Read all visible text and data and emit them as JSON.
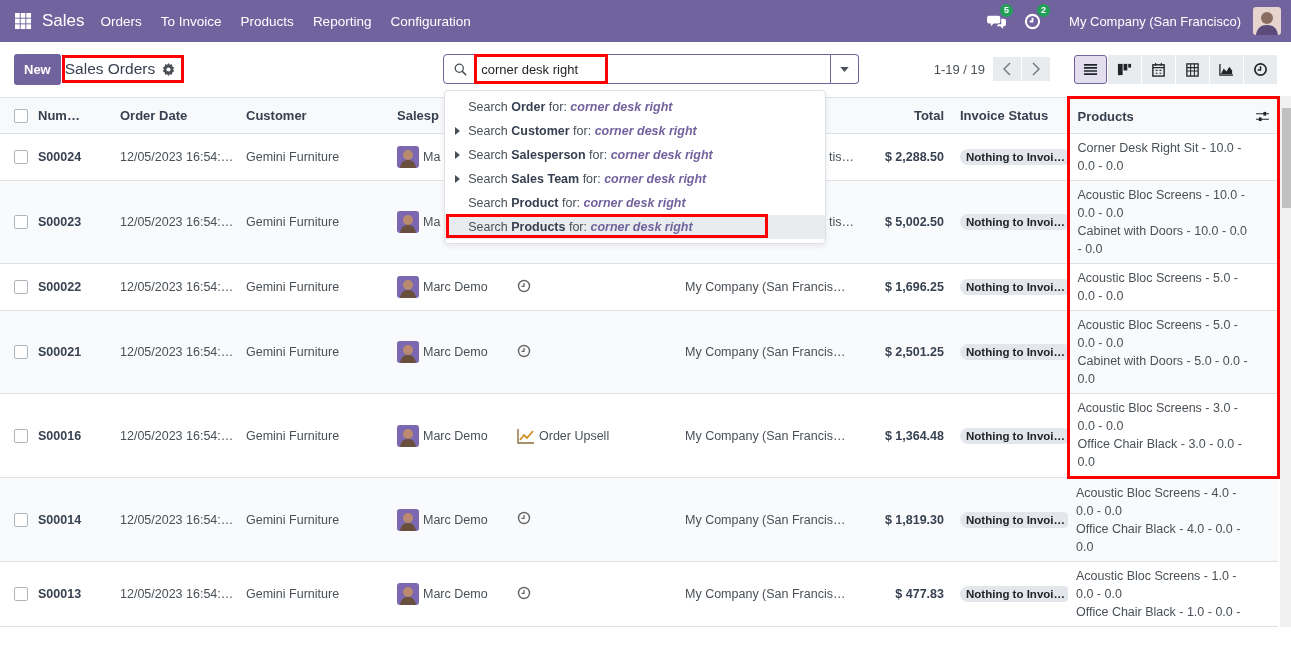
{
  "navbar": {
    "app": "Sales",
    "menu": [
      "Orders",
      "To Invoice",
      "Products",
      "Reporting",
      "Configuration"
    ],
    "systray": [
      {
        "kind": "chat",
        "count": "5"
      },
      {
        "kind": "activity",
        "count": "2"
      }
    ],
    "company": "My Company (San Francisco)"
  },
  "control_panel": {
    "new_button": "New",
    "title": {
      "text": "Sales Orders",
      "highlighted": true
    },
    "search": {
      "value": "corner desk right",
      "highlighted": true
    },
    "pager": "1-19 / 19",
    "views": [
      {
        "kind": "list",
        "selected": true
      },
      {
        "kind": "kanban",
        "selected": false
      },
      {
        "kind": "calendar",
        "selected": false
      },
      {
        "kind": "pivot",
        "selected": false
      },
      {
        "kind": "graph",
        "selected": false
      },
      {
        "kind": "activity",
        "selected": false
      }
    ]
  },
  "search_dropdown": [
    {
      "text": "Search **Order** for: *corner desk right*",
      "expandable": false,
      "selected": false,
      "highlighted": false
    },
    {
      "text": "Search **Customer** for: *corner desk right*",
      "expandable": true,
      "selected": false,
      "highlighted": false
    },
    {
      "text": "Search **Salesperson** for: *corner desk right*",
      "expandable": true,
      "selected": false,
      "highlighted": false
    },
    {
      "text": "Search **Sales Team** for: *corner desk right*",
      "expandable": true,
      "selected": false,
      "highlighted": false
    },
    {
      "text": "Search **Product** for: *corner desk right*",
      "expandable": false,
      "selected": false,
      "highlighted": false
    },
    {
      "text": "Search **Products** for: *corner desk right*",
      "expandable": false,
      "selected": true,
      "highlighted": true
    }
  ],
  "table": {
    "columns": {
      "number": "Num…",
      "order_date": "Order Date",
      "customer": "Customer",
      "salesperson": "Salesp",
      "total": "Total",
      "invoice_status": "Invoice Status",
      "products": "Products"
    },
    "products_highlighted": true,
    "all_checked": false,
    "rows": [
      {
        "checked": false,
        "number": "S00024",
        "order_date": "12/05/2023 16:54:…",
        "customer": "Gemini Furniture",
        "salesperson": "Ma",
        "activity": {
          "kind": "none"
        },
        "company": "tis…",
        "company_covered": true,
        "total": "$ 2,288.50",
        "invoice_status": "Nothing to Invoi…",
        "products": [
          "Corner Desk Right Sit - 10.0 - 0.0 - 0.0"
        ],
        "products_highlighted": true
      },
      {
        "checked": false,
        "number": "S00023",
        "order_date": "12/05/2023 16:54:…",
        "customer": "Gemini Furniture",
        "salesperson": "Ma",
        "activity": {
          "kind": "none"
        },
        "company": "tis…",
        "company_covered": true,
        "total": "$ 5,002.50",
        "invoice_status": "Nothing to Invoi…",
        "products": [
          "Acoustic Bloc Screens - 10.0 - 0.0 - 0.0",
          "Cabinet with Doors - 10.0 - 0.0 - 0.0"
        ],
        "products_highlighted": true
      },
      {
        "checked": false,
        "number": "S00022",
        "order_date": "12/05/2023 16:54:…",
        "customer": "Gemini Furniture",
        "salesperson": "Marc Demo",
        "activity": {
          "kind": "clock"
        },
        "company": "My Company (San Francis…",
        "company_covered": false,
        "total": "$ 1,696.25",
        "invoice_status": "Nothing to Invoi…",
        "products": [
          "Acoustic Bloc Screens - 5.0 - 0.0 - 0.0"
        ],
        "products_highlighted": true
      },
      {
        "checked": false,
        "number": "S00021",
        "order_date": "12/05/2023 16:54:…",
        "customer": "Gemini Furniture",
        "salesperson": "Marc Demo",
        "activity": {
          "kind": "clock"
        },
        "company": "My Company (San Francis…",
        "company_covered": false,
        "total": "$ 2,501.25",
        "invoice_status": "Nothing to Invoi…",
        "products": [
          "Acoustic Bloc Screens - 5.0 - 0.0 - 0.0",
          "Cabinet with Doors - 5.0 - 0.0 - 0.0"
        ],
        "products_highlighted": true
      },
      {
        "checked": false,
        "number": "S00016",
        "order_date": "12/05/2023 16:54:…",
        "customer": "Gemini Furniture",
        "salesperson": "Marc Demo",
        "activity": {
          "kind": "upsell",
          "label": "Order Upsell"
        },
        "company": "My Company (San Francis…",
        "company_covered": false,
        "total": "$ 1,364.48",
        "invoice_status": "Nothing to Invoi…",
        "products": [
          "Acoustic Bloc Screens - 3.0 - 0.0 - 0.0",
          "Office Chair Black - 3.0 - 0.0 - 0.0"
        ],
        "products_highlighted": true
      },
      {
        "checked": false,
        "number": "S00014",
        "order_date": "12/05/2023 16:54:…",
        "customer": "Gemini Furniture",
        "salesperson": "Marc Demo",
        "activity": {
          "kind": "clock"
        },
        "company": "My Company (San Francis…",
        "company_covered": false,
        "total": "$ 1,819.30",
        "invoice_status": "Nothing to Invoi…",
        "products": [
          "Acoustic Bloc Screens - 4.0 - 0.0 - 0.0",
          "Office Chair Black - 4.0 - 0.0 - 0.0"
        ],
        "products_highlighted": false
      },
      {
        "checked": false,
        "number": "S00013",
        "order_date": "12/05/2023 16:54:…",
        "customer": "Gemini Furniture",
        "salesperson": "Marc Demo",
        "activity": {
          "kind": "clock"
        },
        "company": "My Company (San Francis…",
        "company_covered": false,
        "total": "$ 477.83",
        "invoice_status": "Nothing to Invoi…",
        "products": [
          "Acoustic Bloc Screens - 1.0 - 0.0 - 0.0",
          "Office Chair Black - 1.0 - 0.0 -"
        ],
        "products_highlighted": false
      }
    ]
  }
}
